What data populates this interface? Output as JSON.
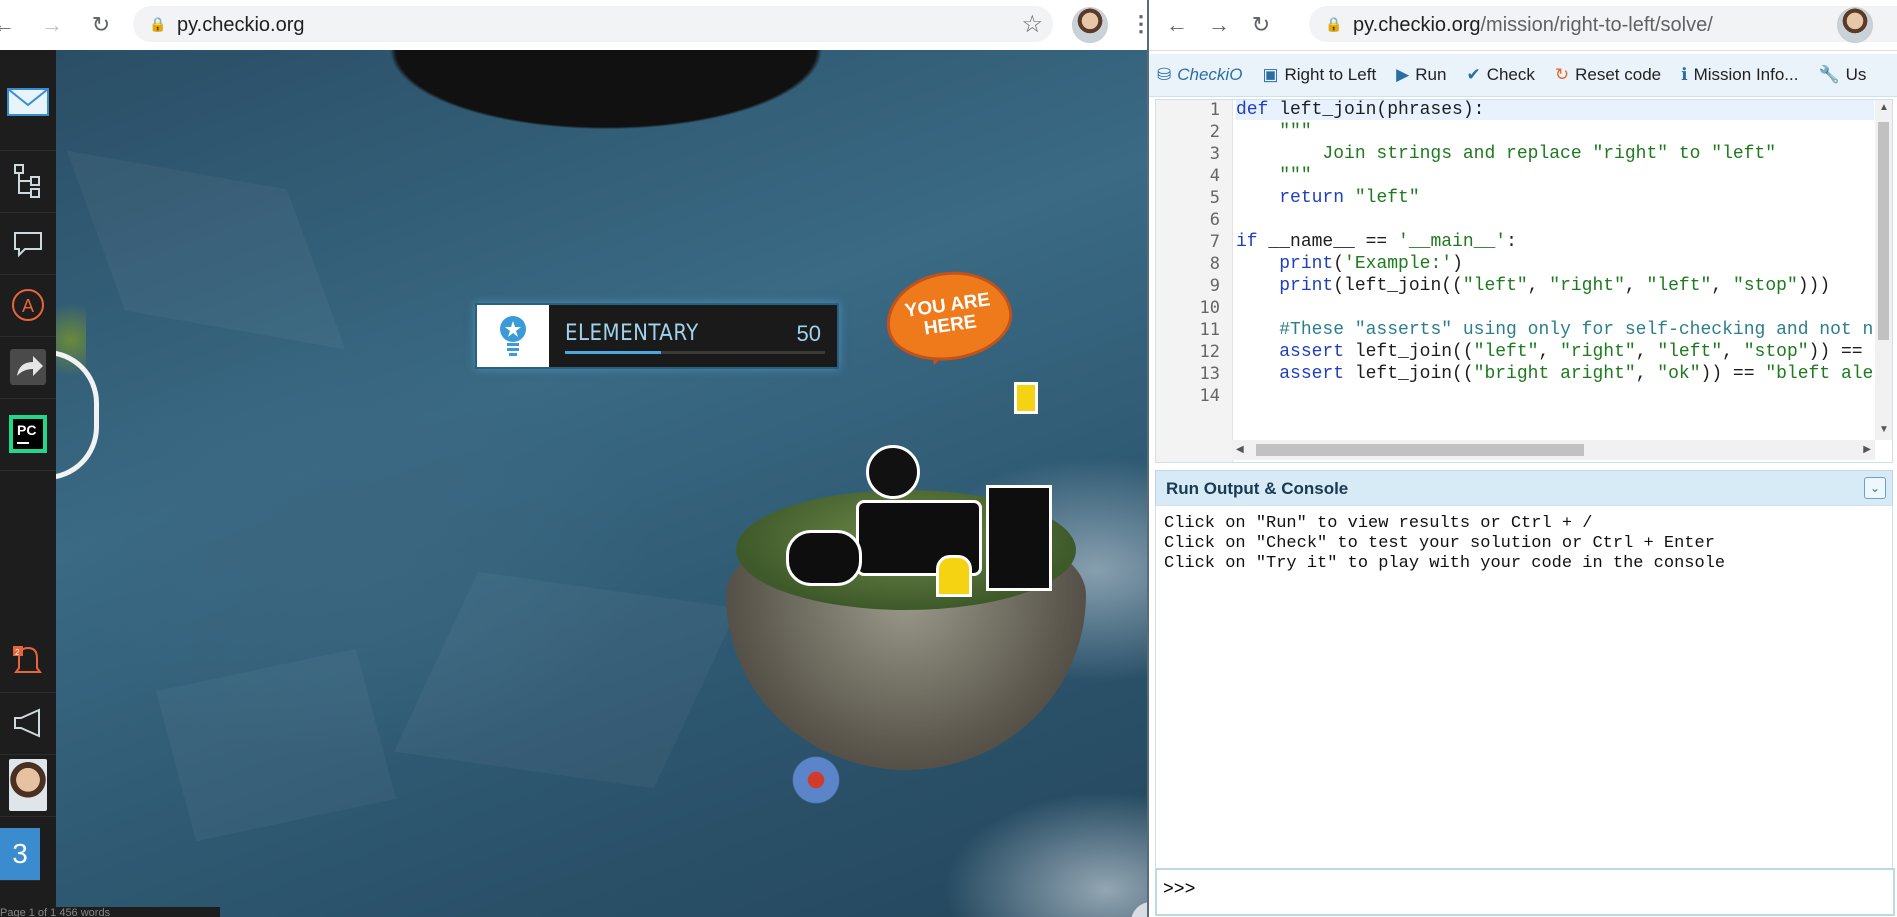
{
  "left_browser": {
    "url": "py.checkio.org",
    "nav": {
      "back": "back-arrow-icon",
      "forward": "forward-arrow-icon",
      "reload": "reload-icon"
    }
  },
  "sidebar": {
    "items": [
      {
        "icon": "envelope-icon",
        "glyph": "✉"
      },
      {
        "icon": "tree-icon",
        "glyph": "⊢"
      },
      {
        "icon": "speech-bubble-icon",
        "glyph": "◇"
      },
      {
        "icon": "a-circle-icon",
        "glyph": "Ⓐ"
      },
      {
        "icon": "share-icon",
        "glyph": "➦"
      },
      {
        "icon": "pycharm-icon",
        "glyph": "PC"
      },
      {
        "icon": "notification-bell-icon",
        "glyph": "🔔"
      },
      {
        "icon": "megaphone-icon",
        "glyph": "📢"
      },
      {
        "icon": "avatar-icon",
        "glyph": ""
      },
      {
        "icon": "level-number-icon",
        "glyph": "3"
      }
    ],
    "status_text": "Page 1 of 1   456 words"
  },
  "map": {
    "level_name": "ELEMENTARY",
    "level_points": "50",
    "level_progress": 0.37,
    "badge_line1": "YOU ARE",
    "badge_line2": "HERE"
  },
  "right_browser": {
    "url_host": "py.checkio.org",
    "url_path": "/mission/right-to-left/solve/"
  },
  "toolbar": {
    "logo": "CheckiO",
    "mission": "Right to Left",
    "run": "Run",
    "check": "Check",
    "reset": "Reset code",
    "info": "Mission Info...",
    "extra": "Us"
  },
  "editor": {
    "line_numbers": [
      "1",
      "2",
      "3",
      "4",
      "5",
      "6",
      "7",
      "8",
      "9",
      "10",
      "11",
      "12",
      "13",
      "14"
    ]
  },
  "console": {
    "title": "Run Output & Console",
    "lines": [
      "Click on \"Run\" to view results or Ctrl + /",
      "Click on \"Check\" to test your solution or Ctrl + Enter",
      "Click on \"Try it\" to play with your code in the console"
    ],
    "prompt": ">>>"
  },
  "colors": {
    "accent": "#2b6ea6",
    "badge": "#ef7a1c",
    "keyword": "#1f3fbf",
    "string": "#1e7a1e"
  }
}
